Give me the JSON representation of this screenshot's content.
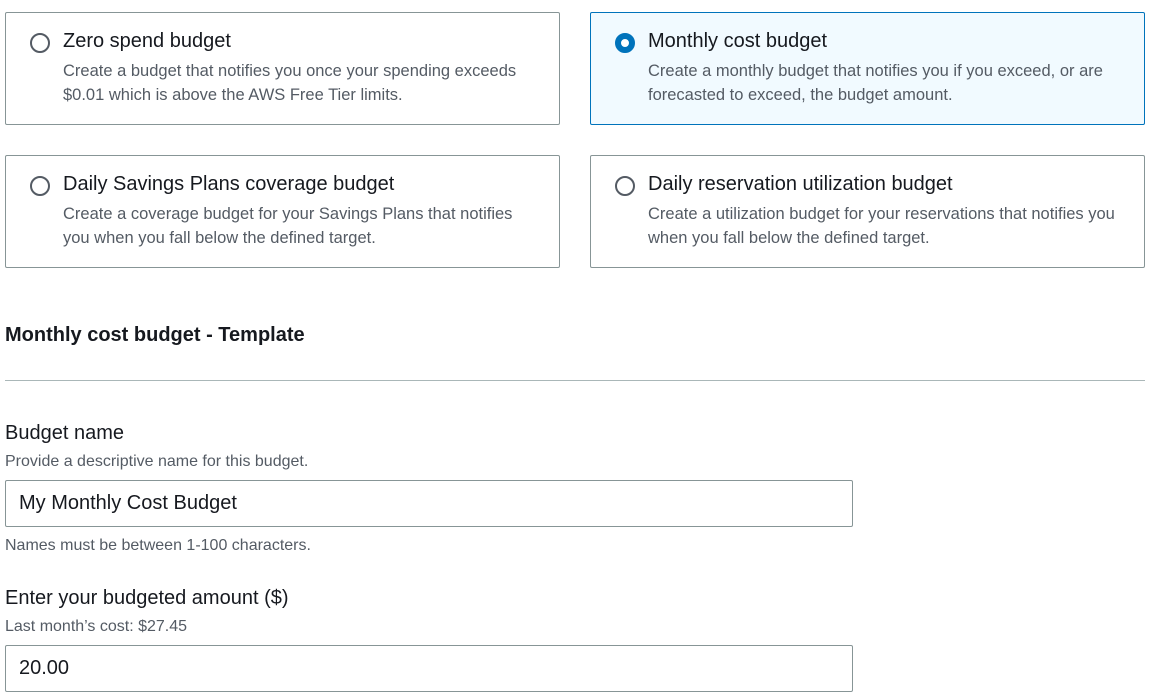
{
  "budget_types": [
    {
      "title": "Zero spend budget",
      "description": "Create a budget that notifies you once your spending exceeds $0.01 which is above the AWS Free Tier limits.",
      "selected": false
    },
    {
      "title": "Monthly cost budget",
      "description": "Create a monthly budget that notifies you if you exceed, or are forecasted to exceed, the budget amount.",
      "selected": true
    },
    {
      "title": "Daily Savings Plans coverage budget",
      "description": "Create a coverage budget for your Savings Plans that notifies you when you fall below the defined target.",
      "selected": false
    },
    {
      "title": "Daily reservation utilization budget",
      "description": "Create a utilization budget for your reservations that notifies you when you fall below the defined target.",
      "selected": false
    }
  ],
  "template": {
    "section_title": "Monthly cost budget - Template",
    "budget_name": {
      "label": "Budget name",
      "description": "Provide a descriptive name for this budget.",
      "value": "My Monthly Cost Budget",
      "constraint": "Names must be between 1-100 characters."
    },
    "budget_amount": {
      "label": "Enter your budgeted amount ($)",
      "description": "Last month’s cost: $27.45",
      "value": "20.00"
    }
  },
  "colors": {
    "accent": "#0073bb",
    "selected_bg": "#f1faff",
    "border": "#879596",
    "secondary_text": "#545b64"
  }
}
